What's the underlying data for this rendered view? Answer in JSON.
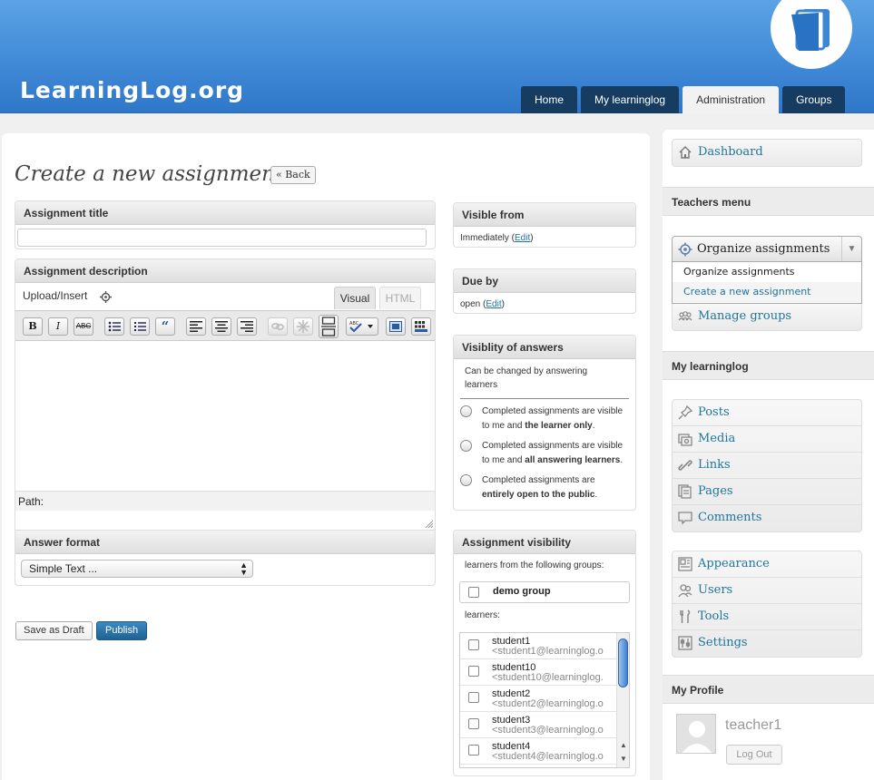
{
  "site": {
    "logo_text": "LearningLog.org"
  },
  "nav": {
    "tabs": [
      "Home",
      "My learninglog",
      "Administration",
      "Groups"
    ],
    "active": "Administration"
  },
  "page": {
    "title": "Create a new assignment",
    "back_label": "« Back"
  },
  "assignment_title": {
    "label": "Assignment title",
    "value": ""
  },
  "description": {
    "label": "Assignment description",
    "upload_label": "Upload/Insert",
    "tab_visual": "Visual",
    "tab_html": "HTML",
    "toolbar": [
      "B",
      "I",
      "ABC"
    ],
    "path_label": "Path:"
  },
  "answer_format": {
    "label": "Answer format",
    "selected": "Simple Text ..."
  },
  "actions": {
    "save_draft": "Save as Draft",
    "publish": "Publish"
  },
  "visible_from": {
    "label": "Visible from",
    "value": "Immediately",
    "edit": "Edit"
  },
  "due_by": {
    "label": "Due by",
    "value": "open",
    "edit": "Edit"
  },
  "visibility_answers": {
    "label": "Visiblity of answers",
    "note": "Can be changed by answering learners",
    "options": [
      {
        "pre": "Completed assignments are visible to me and ",
        "bold": "the learner only",
        "post": "."
      },
      {
        "pre": "Completed assignments are visible to me and ",
        "bold": "all answering learners",
        "post": "."
      },
      {
        "pre": "Completed assignments are ",
        "bold": "entirely open to the public",
        "post": "."
      }
    ]
  },
  "assignment_visibility": {
    "label": "Assignment visibility",
    "groups_note": "learners from the following groups:",
    "group": "demo group",
    "learners_label": "learners:",
    "students": [
      {
        "name": "student1",
        "email": "<student1@learninglog.o"
      },
      {
        "name": "student10",
        "email": "<student10@learninglog."
      },
      {
        "name": "student2",
        "email": "<student2@learninglog.o"
      },
      {
        "name": "student3",
        "email": "<student3@learninglog.o"
      },
      {
        "name": "student4",
        "email": "<student4@learninglog.o"
      }
    ]
  },
  "sidebar": {
    "dashboard": "Dashboard",
    "teachers_menu": "Teachers menu",
    "organize": "Organize assignments",
    "organize_sub": [
      "Organize assignments",
      "Create a new assignment"
    ],
    "manage_groups": "Manage groups",
    "my_learninglog": "My learninglog",
    "content_items": [
      "Posts",
      "Media",
      "Links",
      "Pages",
      "Comments"
    ],
    "admin_items": [
      "Appearance",
      "Users",
      "Tools",
      "Settings"
    ],
    "my_profile": "My Profile",
    "username": "teacher1",
    "logout": "Log Out"
  }
}
